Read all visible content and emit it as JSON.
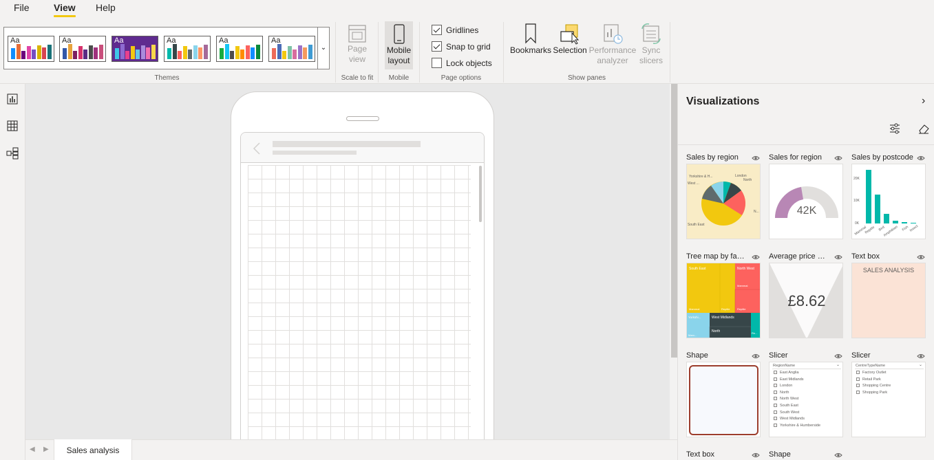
{
  "menu": {
    "file": "File",
    "view": "View",
    "help": "Help"
  },
  "ribbon": {
    "themes_label": "Themes",
    "theme_aa": "Aa",
    "themes": [
      {
        "bg": "#ffffff",
        "colors": [
          "#118dff",
          "#e66c37",
          "#6b007b",
          "#e044a7",
          "#744ec2",
          "#d9b300",
          "#d64550",
          "#197278"
        ]
      },
      {
        "bg": "#ffffff",
        "colors": [
          "#3257a8",
          "#e8a33c",
          "#7d1f61",
          "#d6336c",
          "#5b2c83",
          "#4c4c4c",
          "#a0317d",
          "#c94f7c"
        ]
      },
      {
        "bg": "#5f2b8f",
        "colors": [
          "#3fc6e8",
          "#8e6bd1",
          "#e8418d",
          "#f2c811",
          "#65c7e6",
          "#a98bdc",
          "#f06fb0",
          "#f7d84b"
        ]
      },
      {
        "bg": "#ffffff",
        "colors": [
          "#01b8aa",
          "#374649",
          "#fd625e",
          "#f2c80f",
          "#5f6b6d",
          "#8ad4eb",
          "#fe9666",
          "#a66999"
        ]
      },
      {
        "bg": "#ffffff",
        "colors": [
          "#1aab40",
          "#15c6f4",
          "#4c4c4c",
          "#f2c811",
          "#ff8c00",
          "#fd625e",
          "#118dff",
          "#0a8a3b"
        ]
      },
      {
        "bg": "#ffffff",
        "colors": [
          "#ed6b5a",
          "#4b6cb7",
          "#f2c811",
          "#7dc2a6",
          "#d86c9e",
          "#9c71c6",
          "#f49a5e",
          "#3f9bd3"
        ]
      }
    ],
    "page_view": "Page view",
    "scale_label": "Scale to fit",
    "mobile_layout": "Mobile layout",
    "mobile_label": "Mobile",
    "gridlines": "Gridlines",
    "snap_to_grid": "Snap to grid",
    "lock_objects": "Lock objects",
    "page_options_label": "Page options",
    "bookmarks": "Bookmarks",
    "selection": "Selection",
    "performance_analyzer": "Performance analyzer",
    "sync_slicers": "Sync slicers",
    "show_panes_label": "Show panes",
    "gridlines_checked": true,
    "snap_checked": true,
    "lock_checked": false
  },
  "tabs": {
    "page": "Sales analysis"
  },
  "pane": {
    "title": "Visualizations",
    "cards": [
      {
        "title": "Sales by region"
      },
      {
        "title": "Sales for region",
        "gauge_value": "42K"
      },
      {
        "title": "Sales by postcode",
        "ticks": [
          "20K",
          "10K",
          "0K"
        ],
        "xcats": [
          "Mammal",
          "Reptile",
          "Bird",
          "Amphibian",
          "Fish",
          "Insect"
        ]
      },
      {
        "title": "Tree map by fam...",
        "tiles": [
          "South East",
          "North West",
          "Mammal",
          "Mammal",
          "Reptile",
          "Reptile",
          "Yorkshi...",
          "West Midlands",
          "North",
          "Mam...",
          "Re..."
        ]
      },
      {
        "title": "Average price KPI",
        "kpi_value": "£8.62"
      },
      {
        "title": "Text box",
        "text": "SALES ANALYSIS"
      },
      {
        "title": "Shape"
      },
      {
        "title": "Slicer",
        "header": "RegionName",
        "items": [
          "East Anglia",
          "East Midlands",
          "London",
          "North",
          "North West",
          "South East",
          "South West",
          "West Midlands",
          "Yorkshire & Humberside"
        ]
      },
      {
        "title": "Slicer",
        "header": "CentreTypeName",
        "items": [
          "Factory Outlet",
          "Retail Park",
          "Shopping Centre",
          "Shopping Park"
        ]
      },
      {
        "title": "Text box"
      },
      {
        "title": "Shape"
      }
    ],
    "pie_labels": [
      "Yorkshire & H...",
      "London",
      "North",
      "West ...",
      "N...",
      "South East"
    ]
  },
  "colors": {
    "accent": "#f2c811",
    "teal": "#01b8aa",
    "dark": "#374649",
    "red": "#fd625e",
    "yellow": "#f2c80f",
    "lightblue": "#8ad4eb",
    "gauge": "#b887b5"
  }
}
